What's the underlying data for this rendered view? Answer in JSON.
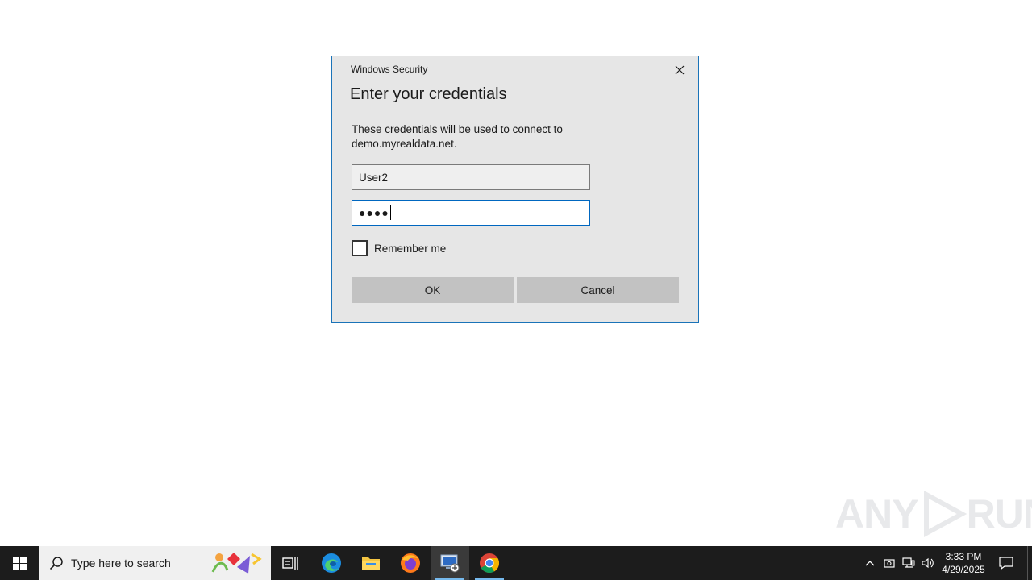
{
  "dialog": {
    "title": "Windows Security",
    "heading": "Enter your credentials",
    "message": "These credentials will be used to connect to demo.myrealdata.net.",
    "username_value": "User2",
    "password_masked": "●●●●",
    "remember_label": "Remember me",
    "remember_checked": false,
    "ok_label": "OK",
    "cancel_label": "Cancel"
  },
  "watermark": {
    "text_left": "ANY",
    "text_right": "RUN"
  },
  "taskbar": {
    "search_placeholder": "Type here to search",
    "apps": [
      "task-view",
      "edge",
      "file-explorer",
      "firefox",
      "remote-desktop",
      "chrome"
    ],
    "active_app": "remote-desktop",
    "clock_time": "3:33 PM",
    "clock_date": "4/29/2025"
  },
  "colors": {
    "dialog_border": "#1a73b8",
    "focus_border": "#0067c0",
    "taskbar_bg": "#1c1c1c",
    "accent_underline": "#76b9ed"
  }
}
